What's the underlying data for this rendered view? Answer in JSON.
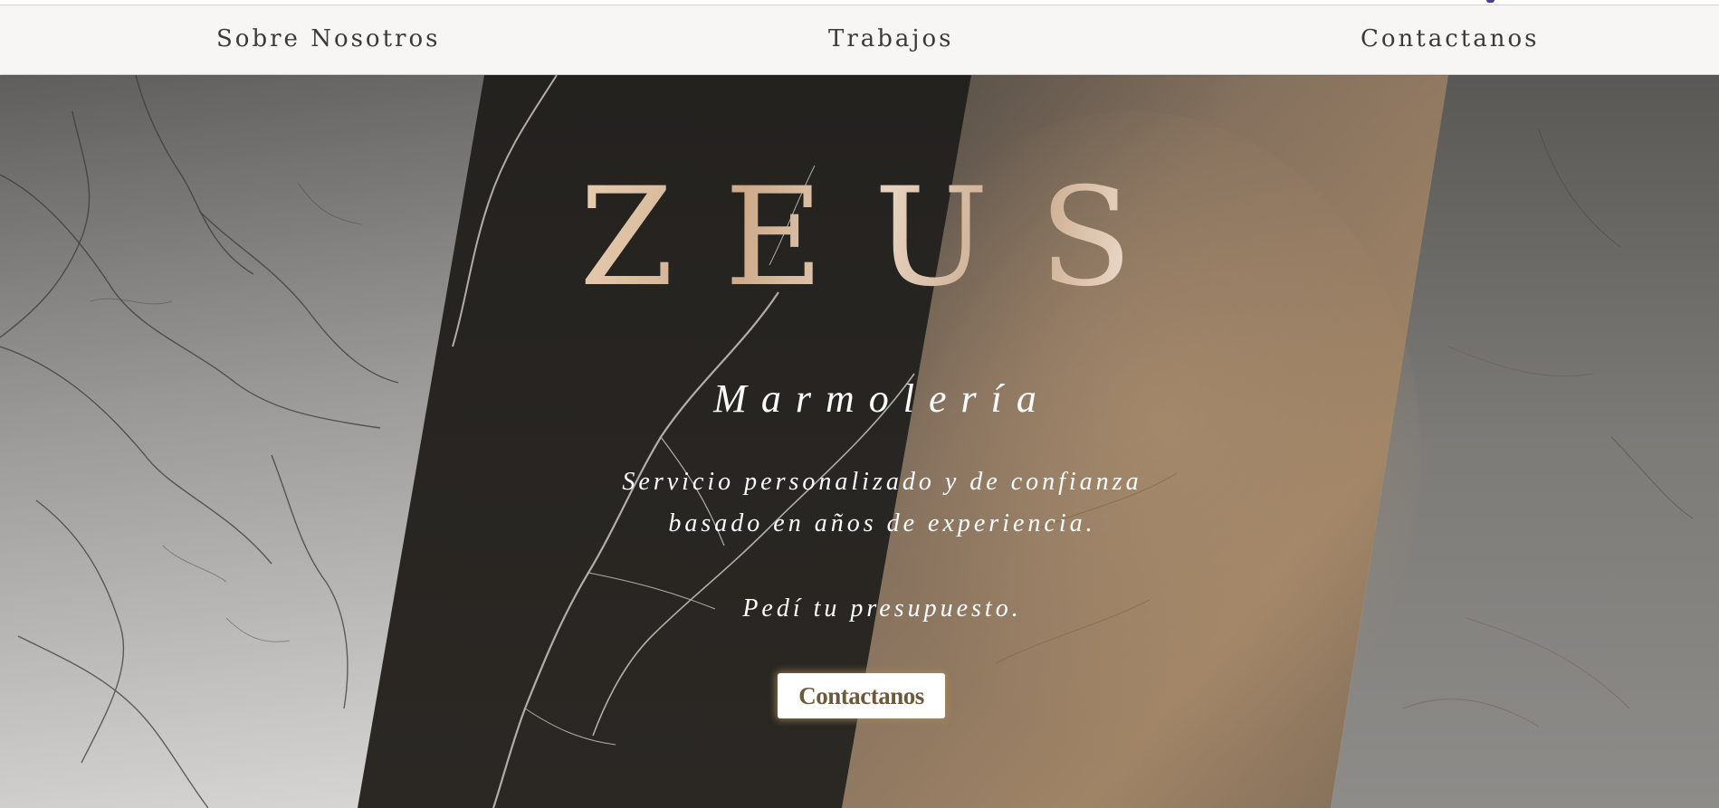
{
  "nav": {
    "items": [
      {
        "label": "Sobre Nosotros"
      },
      {
        "label": "Trabajos"
      },
      {
        "label": "Contactanos"
      }
    ]
  },
  "hero": {
    "brand": "ZEUS",
    "subtitle": "Marmolería",
    "tagline_line1": "Servicio personalizado y de confianza",
    "tagline_line2": "basado en años de experiencia.",
    "cta_text": "Pedí tu presupuesto.",
    "cta_button_label": "Contactanos"
  },
  "colors": {
    "nav_background": "#f7f6f4",
    "brand_gold": "#dcc2a6",
    "button_text": "#6e5a3a",
    "dark_marble": "#26231f"
  }
}
